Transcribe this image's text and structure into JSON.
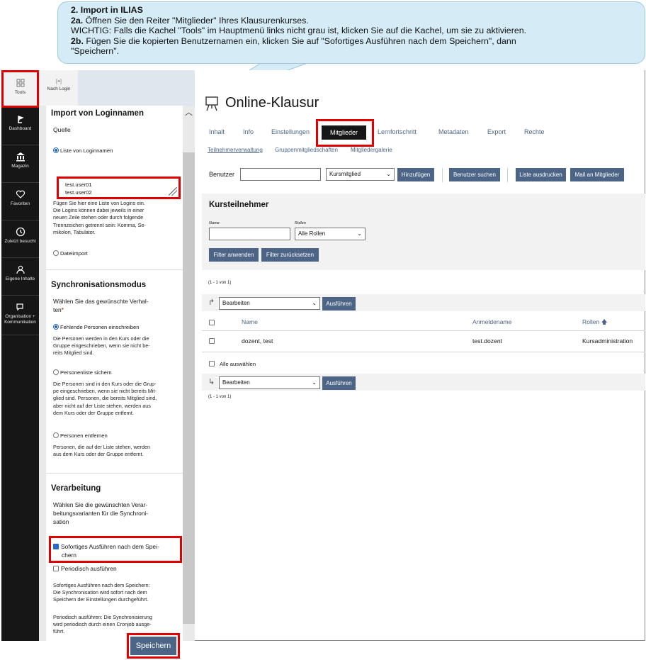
{
  "instructions": {
    "heading": "2. Import in ILIAS",
    "step_2a_label": "2a.",
    "step_2a_text": " Öffnen Sie den Reiter \"Mitglieder\" Ihres Klausurenkurses.",
    "warning_text": "WICHTIG: Falls die Kachel \"Tools\" im Hauptmenü links nicht grau ist, klicken Sie auf die Kachel, um sie zu aktivieren.",
    "step_2b_label": "2b.",
    "step_2b_text_line1": " Fügen Sie die kopierten Benutzernamen ein, klicken Sie auf \"Sofortiges Ausführen nach dem Speichern\", dann",
    "step_2b_text_line2": "\"Speichern\"."
  },
  "mainbar": {
    "items": [
      {
        "label": "Tools",
        "icon": "tools-icon"
      },
      {
        "label": "Dashboard",
        "icon": "dashboard-icon"
      },
      {
        "label": "Magazin",
        "icon": "repository-icon"
      },
      {
        "label": "Favoriten",
        "icon": "heart-icon"
      },
      {
        "label": "Zuletzt besucht",
        "icon": "clock-icon"
      },
      {
        "label": "Eigene Inhalte",
        "icon": "user-icon"
      },
      {
        "label": "Organisation +",
        "label2": "Kommunikation",
        "icon": "chat-icon"
      }
    ]
  },
  "slate": {
    "tool_tab_label": "Nach Login",
    "tool_tab_glyph": "[≡]",
    "import": {
      "title": "Import von Loginnamen",
      "source_label": "Quelle",
      "option_list": "Liste von Loginnamen",
      "textarea_lines": [
        "test.user01",
        "test.user02"
      ],
      "help": [
        "Fügen Sie hier eine Liste von Logins ein.",
        "Die Logins können dabei jeweils in einer",
        "neuen Zeile stehen oder durch folgende",
        "Trennzeichen getrennt sein: Komma, Se-",
        "mikolon, Tabulator."
      ],
      "option_file": "Dateiimport"
    },
    "sync": {
      "title": "Synchronisationsmodus",
      "question_line1": "Wählen Sie das gewünschte Verhal-",
      "question_line2": "ten",
      "required_marker": "*",
      "opt1": "Fehlende Personen einschreiben",
      "opt1_desc": [
        "Die Personen werden in den Kurs oder die",
        "Gruppe eingeschrieben, wenn sie nicht be-",
        "reits Mitglied sind."
      ],
      "opt2": "Personenliste sichern",
      "opt2_desc": [
        "Die Personen sind in den Kurs oder die Grup-",
        "pe eingeschrieben, wenn sie nicht bereits Mit-",
        "glied sind. Personen, die bereits Mitglied sind,",
        "aber nicht auf der Liste stehen, werden aus",
        "dem Kurs oder der Gruppe entfernt."
      ],
      "opt3": "Personen entfernen",
      "opt3_desc": [
        "Personen, die auf der Liste stehen, werden",
        "aus dem Kurs oder der Gruppe entfernt."
      ]
    },
    "processing": {
      "title": "Verarbeitung",
      "question": [
        "Wählen Sie die gewünschten Verar-",
        "beitungsvarianten für die Synchroni-",
        "sation"
      ],
      "chk1_line1": "Sofortiges Ausführen nach dem Spei-",
      "chk1_line2": "chern",
      "chk1_checked": true,
      "chk2": "Periodisch ausführen",
      "chk2_checked": false,
      "desc1": [
        "Sofortiges Ausführen nach dem Speichern:",
        "Die Synchronisation wird sofort nach dem",
        "Speichern der Einstellungen durchgeführt."
      ],
      "desc2": [
        "Periodisch ausführen: Die Synchronisierung",
        "wird periodisch durch einen Cronjob ausge-",
        "führt."
      ]
    },
    "save_label": "Speichern"
  },
  "main": {
    "title": "Online-Klausur",
    "tabs": [
      "Inhalt",
      "Info",
      "Einstellungen",
      "Mitglieder",
      "Lernfortschritt",
      "Metadaten",
      "Export",
      "Rechte"
    ],
    "active_tab": "Mitglieder",
    "subtabs": [
      "Teilnehmerverwaltung",
      "Gruppenmitgliedschaften",
      "Mitgliedergalerie"
    ],
    "toolbar": {
      "user_label": "Benutzer",
      "user_value": "",
      "role_select": "Kursmitglied",
      "add": "Hinzufügen",
      "search": "Benutzer suchen",
      "print": "Liste ausdrucken",
      "mail": "Mail an Mitglieder"
    },
    "participants": {
      "title": "Kursteilnehmer",
      "filter_name_label": "Name",
      "filter_name_value": "",
      "filter_roles_label": "Rollen",
      "filter_roles_value": "Alle Rollen",
      "apply": "Filter anwenden",
      "reset": "Filter zurücksetzen",
      "pager_top": "(1 - 1 von 1)",
      "pager_bottom": "(1 - 1 von 1)",
      "action_select": "Bearbeiten",
      "action_button": "Ausführen",
      "columns": {
        "name": "Name",
        "login": "Anmeldename",
        "roles": "Rollen"
      },
      "sort_indicator": "🡅",
      "rows": [
        {
          "name": "dozent, test",
          "login": "test.dozent",
          "roles": "Kursadministration"
        }
      ],
      "select_all": "Alle auswählen"
    }
  },
  "colors": {
    "accent": "#4c6586",
    "highlight": "#e00000",
    "callout": "#d5ecf7",
    "mainbar": "#161616"
  }
}
